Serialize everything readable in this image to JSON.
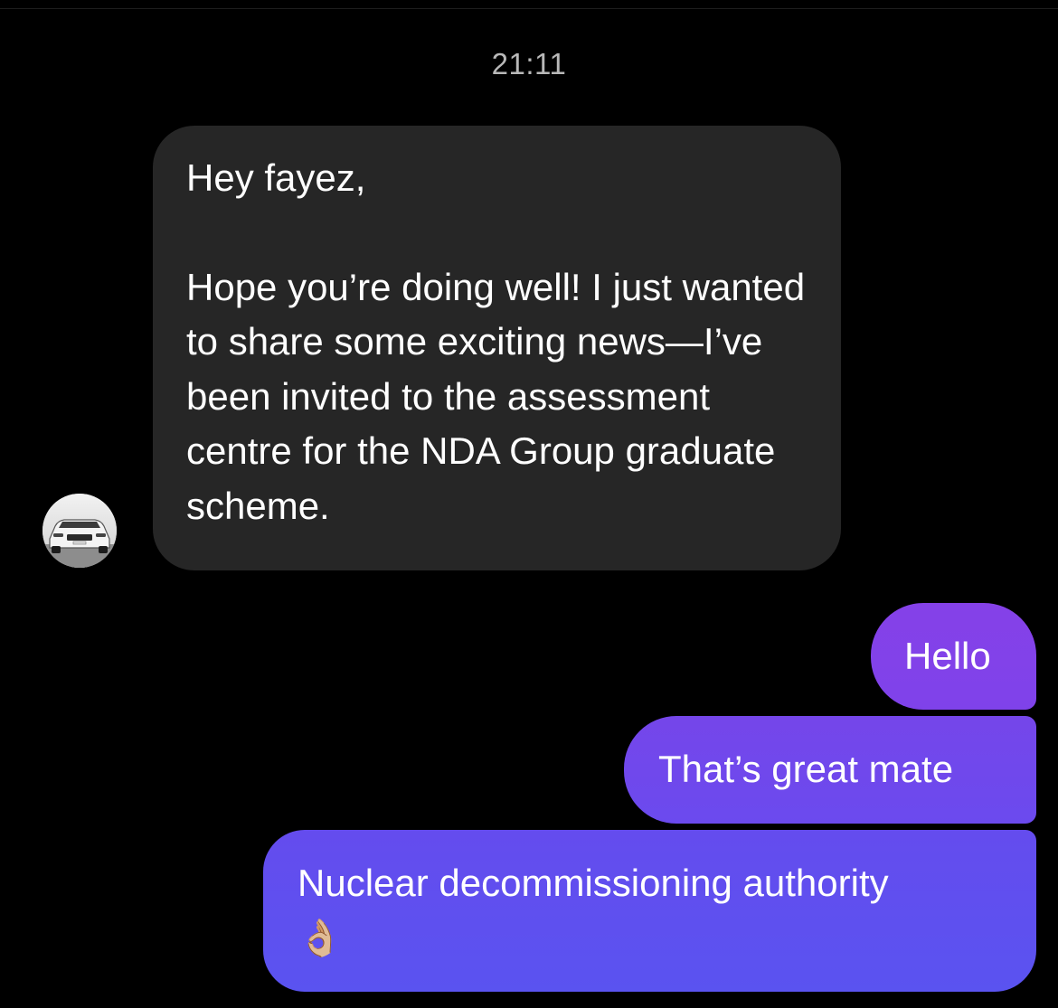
{
  "conversation": {
    "timestamp": "21:11",
    "contact_avatar": "contact-avatar-car-photo",
    "incoming_message": {
      "greeting": "Hey fayez,",
      "body": "Hope you’re doing well! I just wanted to share some exciting news—I’ve been invited to the assessment centre for the NDA Group graduate scheme."
    },
    "outgoing_messages": [
      {
        "text": "Hello"
      },
      {
        "text": "That’s great mate"
      },
      {
        "text": "Nuclear decommissioning authority",
        "emoji": "👌🏼"
      }
    ]
  },
  "colors": {
    "background": "#000000",
    "incoming_bubble": "#262626",
    "outgoing_bubble_top": "#8541e8",
    "outgoing_bubble_bottom": "#5a53f0",
    "timestamp_text": "#b8b8b8"
  }
}
